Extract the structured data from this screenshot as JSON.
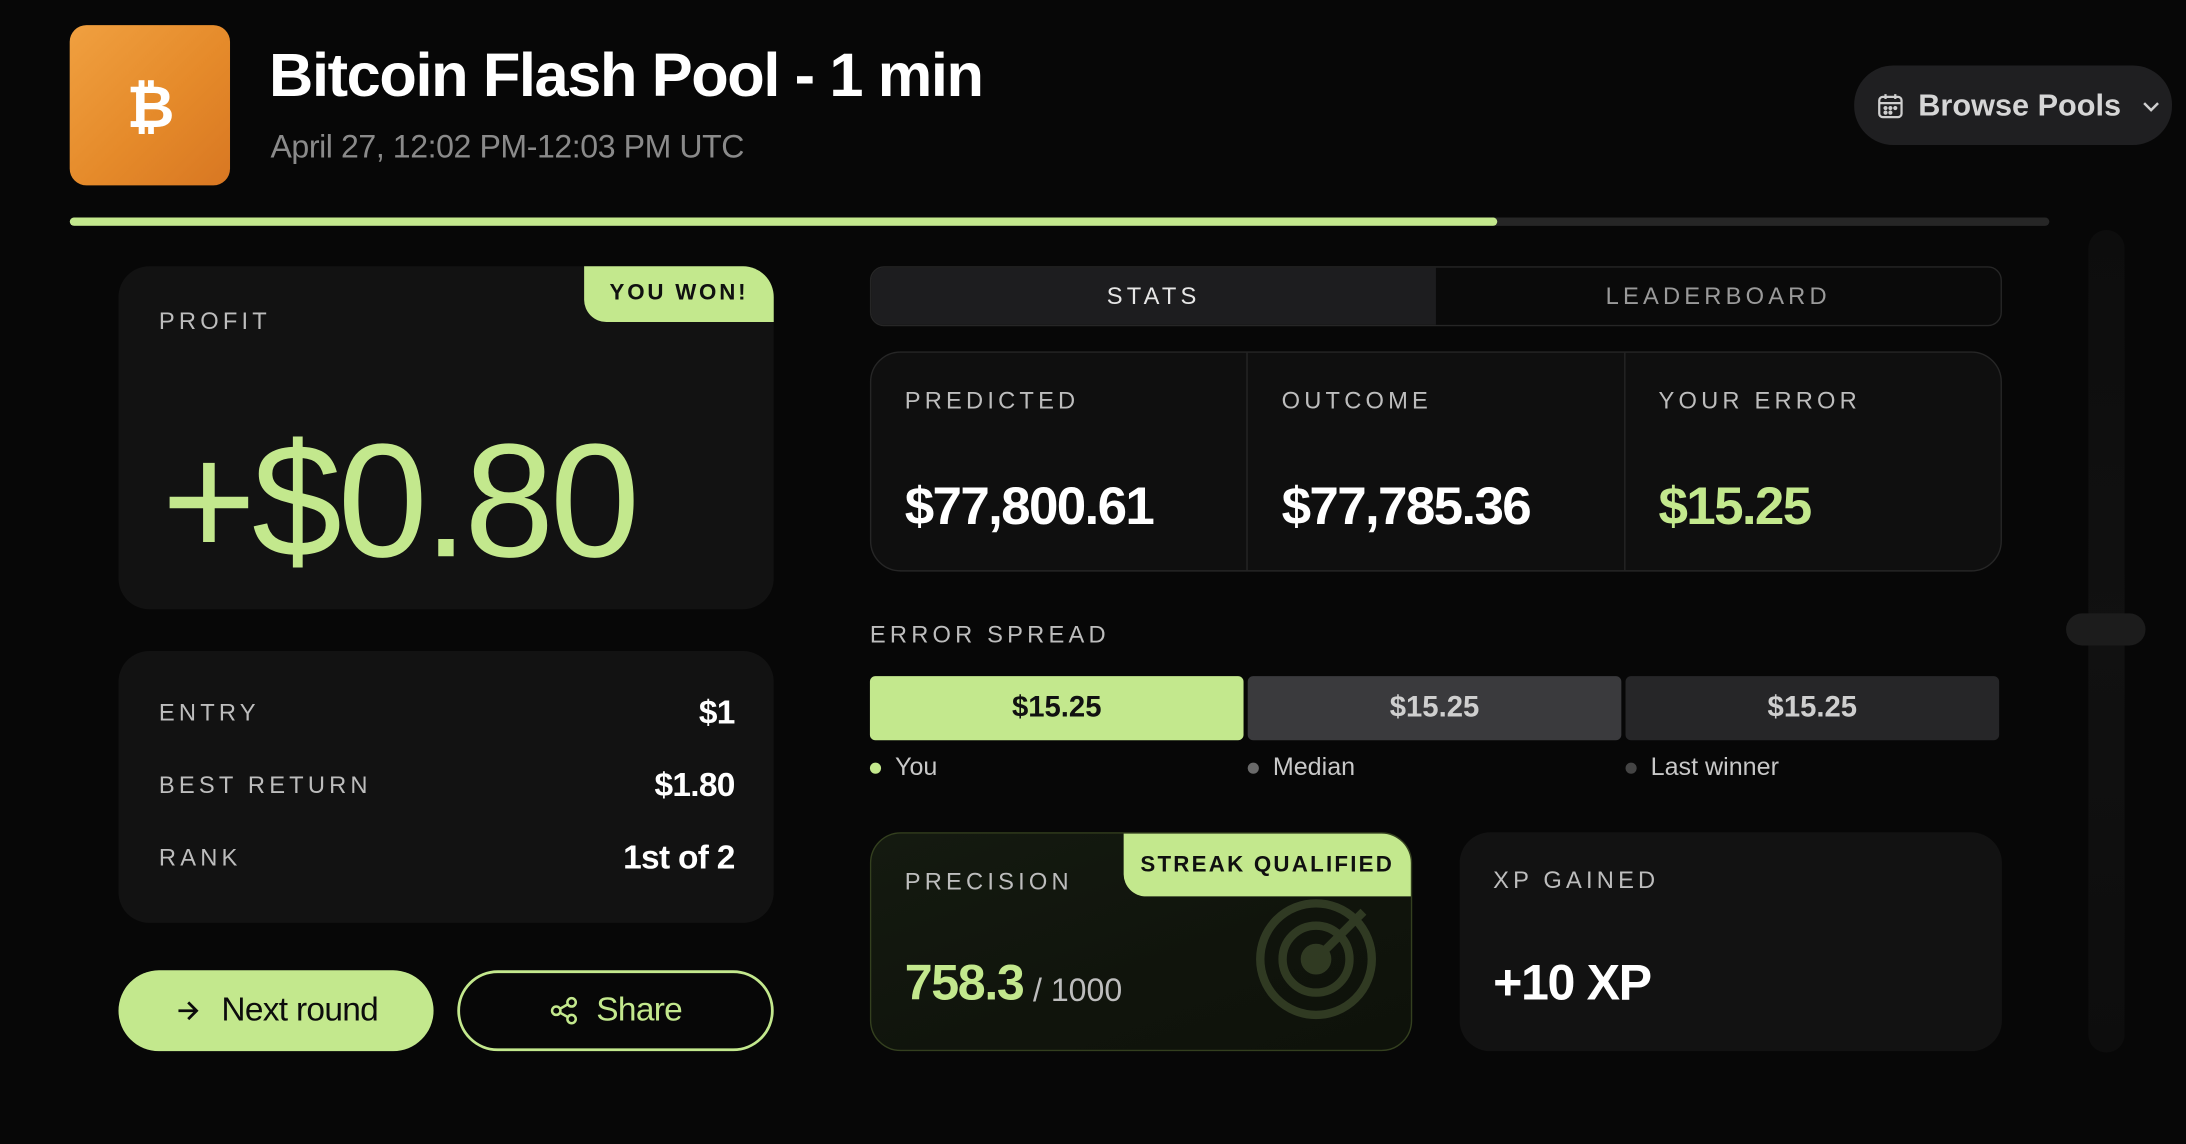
{
  "header": {
    "logo_glyph": "₿",
    "title": "Bitcoin Flash Pool - 1 min",
    "subtitle": "April 27, 12:02 PM-12:03 PM UTC",
    "browse_label": "Browse Pools",
    "progress_fraction": 0.721
  },
  "result": {
    "badge": "YOU WON!",
    "profit_label": "PROFIT",
    "profit_value": "+$0.80"
  },
  "details": {
    "entry_label": "ENTRY",
    "entry_value": "$1",
    "best_return_label": "BEST RETURN",
    "best_return_value": "$1.80",
    "rank_label": "RANK",
    "rank_value": "1st of 2"
  },
  "actions": {
    "next_round_label": "Next round",
    "share_label": "Share"
  },
  "tabs": [
    {
      "label": "STATS",
      "active": true
    },
    {
      "label": "LEADERBOARD",
      "active": false
    }
  ],
  "stats": {
    "predicted_label": "PREDICTED",
    "predicted_value": "$77,800.61",
    "outcome_label": "OUTCOME",
    "outcome_value": "$77,785.36",
    "error_label": "YOUR ERROR",
    "error_value": "$15.25"
  },
  "spread": {
    "label": "ERROR SPREAD",
    "bars": [
      {
        "value": "$15.25",
        "legend": "You"
      },
      {
        "value": "$15.25",
        "legend": "Median"
      },
      {
        "value": "$15.25",
        "legend": "Last winner"
      }
    ]
  },
  "precision": {
    "label": "PRECISION",
    "badge": "STREAK QUALIFIED",
    "value": "758.3",
    "max": "/ 1000"
  },
  "xp": {
    "label": "XP GAINED",
    "value": "+10 XP"
  },
  "colors": {
    "accent": "#c3e88d",
    "logo": "#e58a2a",
    "background": "#070707",
    "card": "#121212"
  }
}
